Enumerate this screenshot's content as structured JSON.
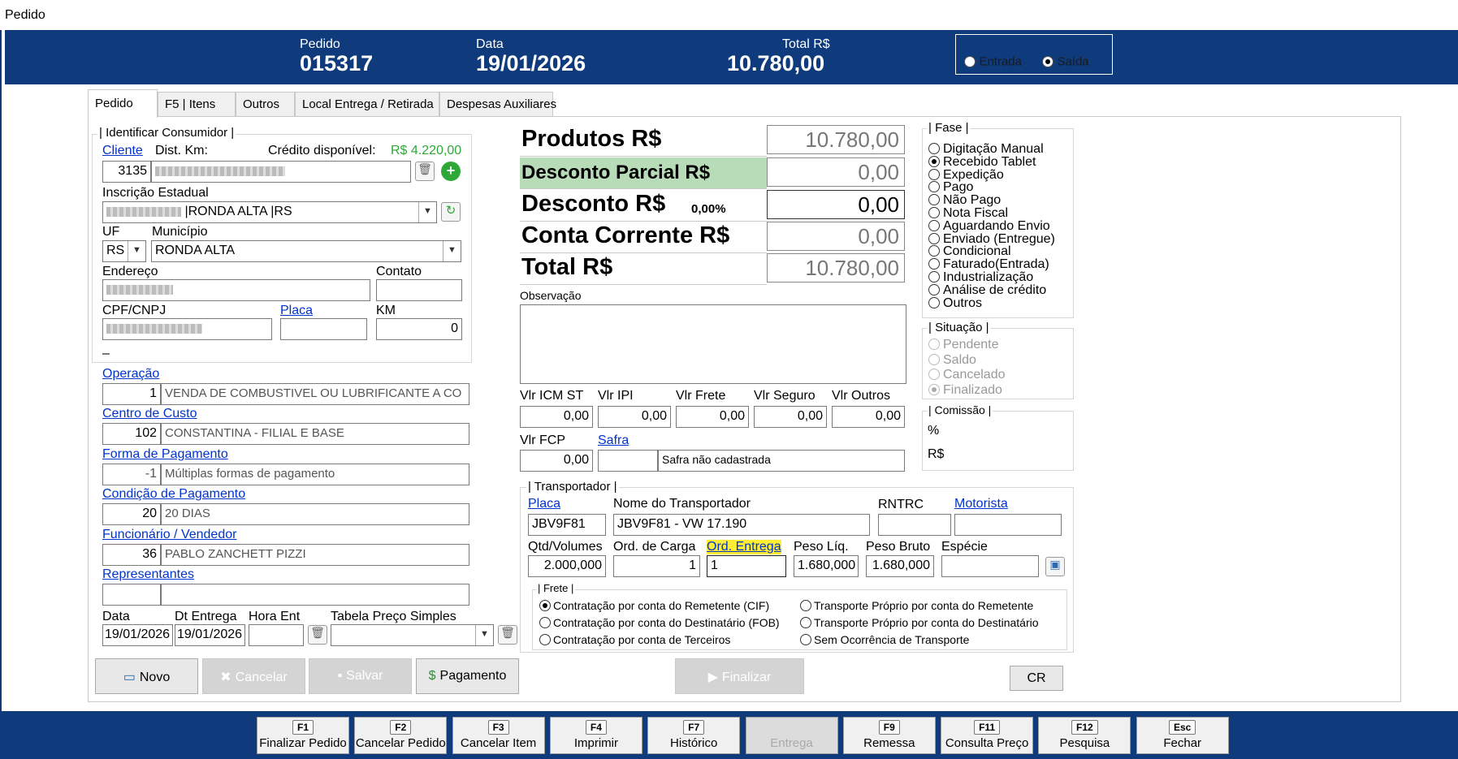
{
  "window": {
    "title": "Pedido"
  },
  "header": {
    "pedido_label": "Pedido",
    "pedido_value": "015317",
    "data_label": "Data",
    "data_value": "19/01/2026",
    "total_label": "Total R$",
    "total_value": "10.780,00",
    "entrada_label": "Entrada",
    "saida_label": "Saída",
    "selected": "Saída"
  },
  "tabs": [
    "Pedido",
    "F5 | Itens",
    "Outros",
    "Local Entrega / Retirada",
    "Despesas Auxiliares"
  ],
  "consumidor": {
    "group_title": "| Identificar Consumidor |",
    "cliente_link": "Cliente",
    "dist_km_label": "Dist. Km:",
    "credito_label": "Crédito disponível:",
    "credito_value": "R$ 4.220,00",
    "cliente_code": "3135",
    "ie_label": "Inscrição Estadual",
    "ie_value": "|RONDA ALTA |RS",
    "uf_label": "UF",
    "uf_value": "RS",
    "municipio_label": "Município",
    "municipio_value": "RONDA ALTA",
    "endereco_label": "Endereço",
    "contato_label": "Contato",
    "cpf_label": "CPF/CNPJ",
    "placa_link": "Placa",
    "km_label": "KM",
    "km_value": "0",
    "dash": "–"
  },
  "operacao": {
    "link": "Operação",
    "code": "1",
    "desc": "VENDA DE COMBUSTIVEL  OU LUBRIFICANTE A  CO"
  },
  "centro_custo": {
    "link": "Centro de Custo",
    "code": "102",
    "desc": "CONSTANTINA - FILIAL E BASE"
  },
  "forma_pagamento": {
    "link": "Forma de Pagamento",
    "code": "-1",
    "desc": "Múltiplas formas de pagamento"
  },
  "condicao_pagamento": {
    "link": "Condição de Pagamento",
    "code": "20",
    "desc": "20 DIAS"
  },
  "funcionario": {
    "link": "Funcionário / Vendedor",
    "code": "36",
    "desc": "PABLO ZANCHETT PIZZI"
  },
  "representantes": {
    "link": "Representantes"
  },
  "datas": {
    "data_label": "Data",
    "data_value": "19/01/2026",
    "dt_entrega_label": "Dt Entrega",
    "dt_entrega_value": "19/01/2026",
    "hora_ent_label": "Hora Ent",
    "tabela_label": "Tabela Preço Simples"
  },
  "totais": {
    "produtos_label": "Produtos R$",
    "produtos_value": "10.780,00",
    "desc_parcial_label": "Desconto Parcial R$",
    "desc_parcial_value": "0,00",
    "desconto_label": "Desconto R$",
    "desconto_pct": "0,00%",
    "desconto_value": "0,00",
    "conta_corrente_label": "Conta Corrente R$",
    "conta_corrente_value": "0,00",
    "total_label": "Total R$",
    "total_value": "10.780,00"
  },
  "observacao": {
    "label": "Observação"
  },
  "valores": {
    "icm_st_label": "Vlr ICM ST",
    "icm_st": "0,00",
    "ipi_label": "Vlr IPI",
    "ipi": "0,00",
    "frete_label": "Vlr Frete",
    "frete": "0,00",
    "seguro_label": "Vlr Seguro",
    "seguro": "0,00",
    "outros_label": "Vlr Outros",
    "outros": "0,00",
    "fcp_label": "Vlr FCP",
    "fcp": "0,00",
    "safra_link": "Safra",
    "safra_desc": "Safra não cadastrada"
  },
  "fase": {
    "title": "| Fase |",
    "options": [
      "Digitação Manual",
      "Recebido Tablet",
      "Expedição",
      "Pago",
      "Não Pago",
      "Nota Fiscal",
      "Aguardando Envio",
      "Enviado (Entregue)",
      "Condicional",
      "Faturado(Entrada)",
      "Industrialização",
      "Análise de crédito",
      "Outros"
    ],
    "selected": "Recebido Tablet"
  },
  "situacao": {
    "title": "| Situação |",
    "options": [
      "Pendente",
      "Saldo",
      "Cancelado",
      "Finalizado"
    ],
    "selected": "Finalizado"
  },
  "comissao": {
    "title": "| Comissão |",
    "pct_label": "%",
    "rs_label": "R$"
  },
  "transportador": {
    "title": "| Transportador |",
    "placa_link": "Placa",
    "placa_value": "JBV9F81",
    "nome_label": "Nome do Transportador",
    "nome_value": "JBV9F81 - VW 17.190",
    "rntrc_label": "RNTRC",
    "motorista_link": "Motorista",
    "qtd_label": "Qtd/Volumes",
    "qtd_value": "2.000,000",
    "ord_carga_label": "Ord. de Carga",
    "ord_carga_value": "1",
    "ord_entrega_label": "Ord. Entrega",
    "ord_entrega_value": "1",
    "peso_liq_label": "Peso Líq.",
    "peso_liq_value": "1.680,000",
    "peso_bruto_label": "Peso Bruto",
    "peso_bruto_value": "1.680,000",
    "especie_label": "Espécie"
  },
  "frete": {
    "title": "| Frete |",
    "options": [
      "Contratação por conta do Remetente (CIF)",
      "Transporte Próprio por conta do Remetente",
      "Contratação por conta do Destinatário (FOB)",
      "Transporte Próprio por conta do Destinatário",
      "Contratação por conta de Terceiros",
      "Sem Ocorrência de Transporte"
    ],
    "selected": "Contratação por conta do Remetente (CIF)"
  },
  "actions": {
    "novo": "Novo",
    "cancelar": "Cancelar",
    "salvar": "Salvar",
    "pagamento": "Pagamento",
    "finalizar": "Finalizar",
    "cr": "CR"
  },
  "footer_keys": [
    {
      "key": "F1",
      "label": "Finalizar Pedido"
    },
    {
      "key": "F2",
      "label": "Cancelar Pedido"
    },
    {
      "key": "F3",
      "label": "Cancelar Item"
    },
    {
      "key": "F4",
      "label": "Imprimir"
    },
    {
      "key": "F7",
      "label": "Histórico"
    },
    {
      "key": "",
      "label": "Entrega"
    },
    {
      "key": "F9",
      "label": "Remessa"
    },
    {
      "key": "F11",
      "label": "Consulta Preço"
    },
    {
      "key": "F12",
      "label": "Pesquisa"
    },
    {
      "key": "Esc",
      "label": "Fechar"
    }
  ],
  "colors": {
    "header_bg": "#0f3b7c",
    "link": "#0033cc",
    "credit": "#2ea836",
    "highlight": "#ffee33"
  }
}
